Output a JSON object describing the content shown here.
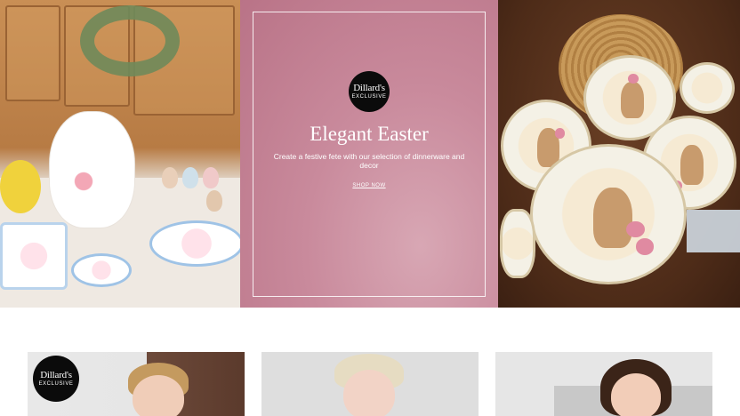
{
  "hero": {
    "logo": {
      "line1": "Dillard's",
      "line2": "EXCLUSIVE"
    },
    "title": "Elegant Easter",
    "subtitle": "Create a festive fete with our selection of dinnerware and decor",
    "cta": "SHOP NOW",
    "colors": {
      "center_panel": "#c98a9c",
      "text": "#ffffff"
    }
  },
  "cards": [
    {
      "logo": {
        "line1": "Dillard's",
        "line2": "EXCLUSIVE"
      }
    },
    {},
    {}
  ]
}
